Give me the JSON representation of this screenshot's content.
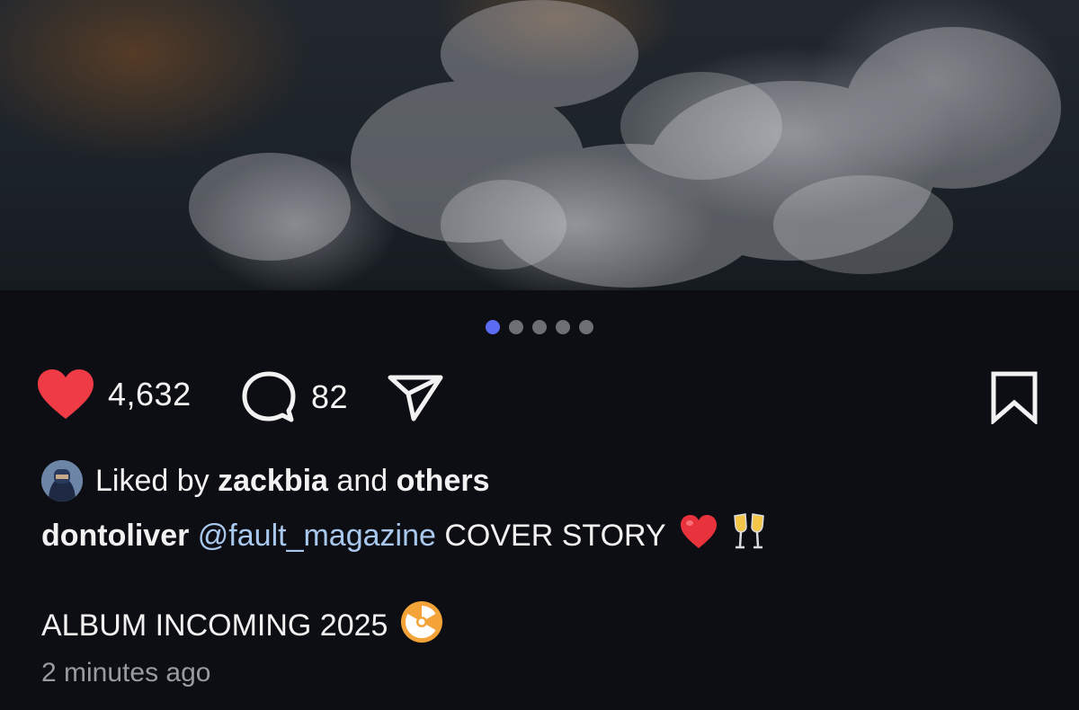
{
  "post": {
    "carousel": {
      "total": 5,
      "active_index": 0
    },
    "likes_count": "4,632",
    "comments_count": "82",
    "liked_by_prefix": "Liked by",
    "liked_by_user": "zackbia",
    "liked_by_and": "and",
    "liked_by_others": "others",
    "author": "dontoliver",
    "mention": "@fault_magazine",
    "caption_text": "COVER STORY",
    "caption_line2": "ALBUM INCOMING 2025",
    "timestamp": "2 minutes ago"
  },
  "icons": {
    "like": "heart-icon",
    "comment": "comment-bubble-icon",
    "share": "paper-plane-icon",
    "save": "bookmark-icon",
    "caption_emojis": [
      "red-heart-emoji",
      "champagne-glasses-emoji"
    ],
    "line2_emoji": "radioactive-emoji"
  },
  "colors": {
    "background": "#0d0e14",
    "like_red": "#ee3b45",
    "mention_blue": "#a9c8ee",
    "carousel_active": "#5b6cf2",
    "carousel_inactive": "#6e6f75",
    "timestamp_gray": "#9a9ba1"
  }
}
